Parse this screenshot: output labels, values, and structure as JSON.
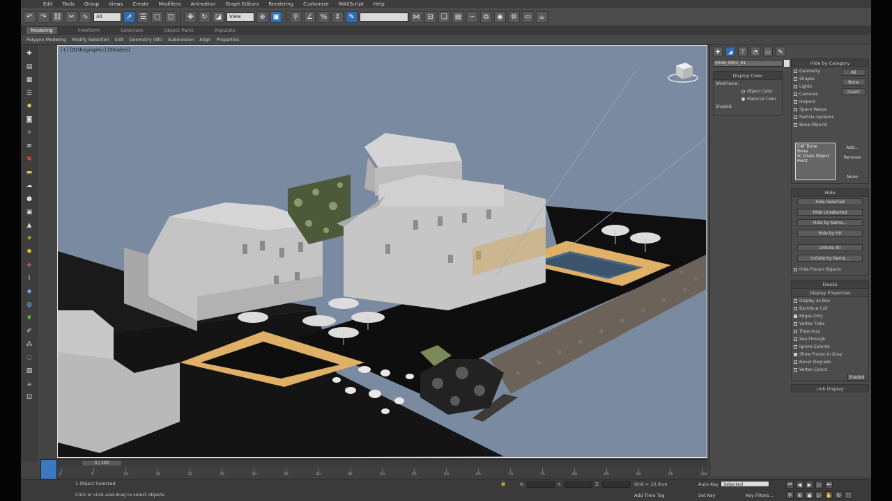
{
  "menu": [
    "Edit",
    "Tools",
    "Group",
    "Views",
    "Create",
    "Modifiers",
    "Animation",
    "Graph Editors",
    "Rendering",
    "Customize",
    "MAXScript",
    "Help"
  ],
  "toolbar": {
    "selection_filter": "All",
    "coord_system": "View",
    "named_selection": "",
    "icons": [
      "undo-icon",
      "redo-icon",
      "link-icon",
      "unlink-icon",
      "bind-icon"
    ]
  },
  "ribbon": {
    "tabs": [
      "Modeling",
      "Freeform",
      "Selection",
      "Object Paint",
      "Populate"
    ],
    "active_tab": "Modeling",
    "sub": [
      "Polygon Modeling",
      "Modify Selection",
      "Edit",
      "Geometry (All)",
      "Subdivision",
      "Align",
      "Properties"
    ]
  },
  "viewport": {
    "label": "[+] [Orthographic] [Shaded]"
  },
  "command_panel": {
    "object_name": "0038_0001_01",
    "display_color": {
      "title": "Display Color",
      "wireframe_label": "Wireframe:",
      "shaded_label": "Shaded:",
      "opt_object": "Object Color",
      "opt_material": "Material Color"
    },
    "hide_by_category": {
      "title": "Hide by Category",
      "items": [
        "Geometry",
        "Shapes",
        "Lights",
        "Cameras",
        "Helpers",
        "Space Warps",
        "Particle Systems",
        "Bone Objects"
      ],
      "buttons": [
        "All",
        "None",
        "Invert"
      ],
      "list": [
        "CAT Bone",
        "Bone",
        "IK Chain Object",
        "Point"
      ],
      "list_buttons": [
        "Add...",
        "Remove",
        "None"
      ]
    },
    "hide": {
      "title": "Hide",
      "buttons": [
        "Hide Selected",
        "Hide Unselected",
        "Hide by Name...",
        "Hide by Hit",
        "Unhide All",
        "Unhide by Name...",
        "Hide Frozen Objects"
      ]
    },
    "display_properties": {
      "title": "Freeze",
      "sub_title": "Display Properties",
      "items": [
        "Display as Box",
        "Backface Cull",
        "Edges Only",
        "Vertex Ticks",
        "Trajectory",
        "See-Through",
        "Ignore Extents",
        "Show Frozen in Gray",
        "Never Degrade",
        "Vertex Colors"
      ],
      "shaded_btn": "Shaded"
    },
    "link_display": "Link Display"
  },
  "timeline": {
    "slider_text": "0 / 100",
    "ticks": [
      "0",
      "5",
      "10",
      "15",
      "20",
      "25",
      "30",
      "35",
      "40",
      "45",
      "50",
      "55",
      "60",
      "65",
      "70",
      "75",
      "80",
      "85",
      "90",
      "95",
      "100"
    ]
  },
  "status": {
    "selected": "1 Object Selected",
    "prompt": "Click or click-and-drag to select objects",
    "x_label": "X:",
    "y_label": "Y:",
    "z_label": "Z:",
    "grid": "Grid = 10.0cm",
    "auto_key": "Auto Key",
    "set_key": "Set Key",
    "selected_dd": "Selected",
    "key_filters": "Key Filters...",
    "add_time_tag": "Add Time Tag"
  },
  "colors": {
    "viewport_bg": "#7a8aa0",
    "accent": "#2f6db5",
    "building": "#cfcfcf",
    "ground": "#0e0e0e",
    "deck": "#e0b066"
  }
}
